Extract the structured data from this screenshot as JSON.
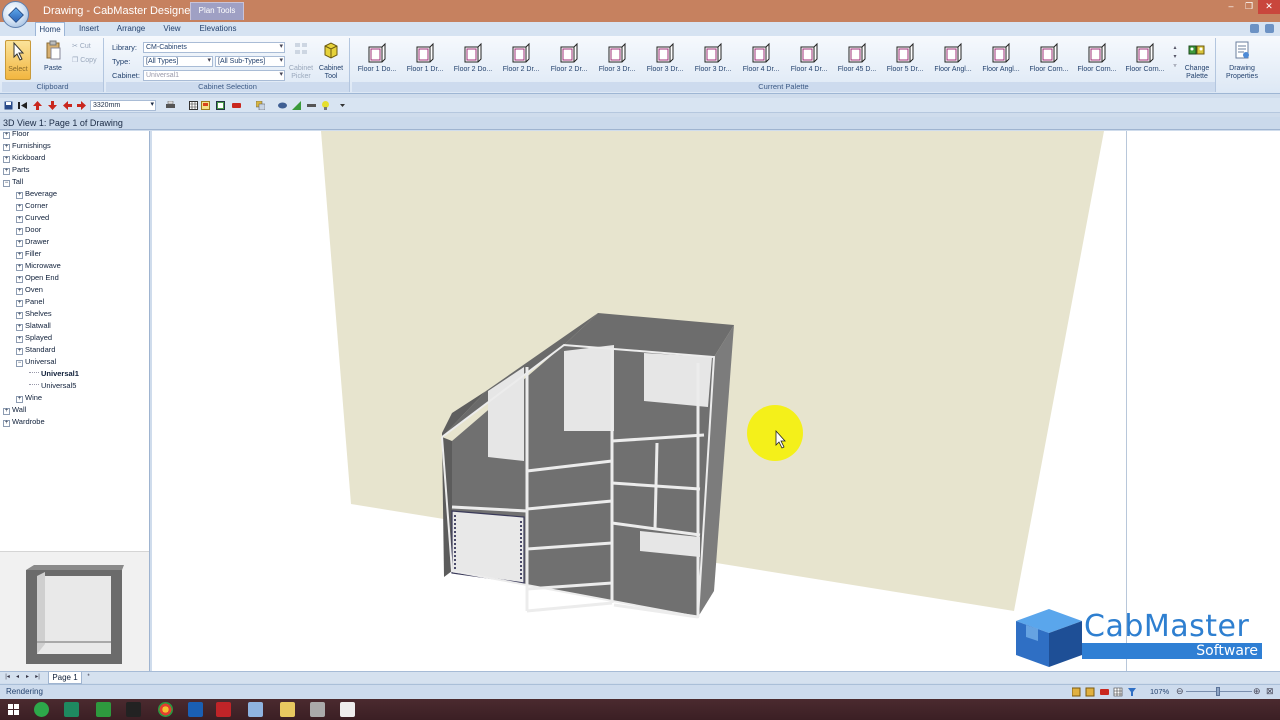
{
  "window": {
    "title": "Drawing - CabMaster Designer",
    "context_tab": "Plan Tools",
    "controls": [
      "–",
      "❐",
      "✕"
    ]
  },
  "tabs": [
    "Home",
    "Insert",
    "Arrange",
    "View",
    "Elevations"
  ],
  "ribbon": {
    "clipboard": {
      "select": "Select",
      "paste": "Paste",
      "cut": "Cut",
      "copy": "Copy",
      "label": "Clipboard"
    },
    "cabinet_selection": {
      "library_label": "Library:",
      "library_value": "CM-Cabinets",
      "type_label": "Type:",
      "type_value": "[All Types]",
      "subtype_value": "[All Sub-Types]",
      "cabinet_label": "Cabinet:",
      "cabinet_value": "Universal1",
      "picker": "Cabinet Picker",
      "tool": "Cabinet Tool",
      "label": "Cabinet Selection"
    },
    "palette": {
      "items": [
        "Floor 1 Do...",
        "Floor 1 Dr...",
        "Floor 2 Do...",
        "Floor 2 Dr...",
        "Floor 2 Dr...",
        "Floor 3 Dr...",
        "Floor 3 Dr...",
        "Floor 3 Dr...",
        "Floor 4 Dr...",
        "Floor 4 Dr...",
        "Floor 45 D...",
        "Floor 5 Dr...",
        "Floor Angl...",
        "Floor Angl...",
        "Floor Corn...",
        "Floor Corn...",
        "Floor Corn..."
      ],
      "label": "Current Palette",
      "change": "Change Palette",
      "drawing_props": "Drawing Properties"
    }
  },
  "toolbar": {
    "zoom_value": "3320mm"
  },
  "view": {
    "header": "3D View 1: Page 1 of Drawing"
  },
  "tree": {
    "root_nodes": [
      "Floor",
      "Furnishings",
      "Kickboard",
      "Parts",
      "Tall"
    ],
    "tall_children": [
      "Beverage",
      "Corner",
      "Curved",
      "Door",
      "Drawer",
      "Filler",
      "Microwave",
      "Open End",
      "Oven",
      "Panel",
      "Shelves",
      "Slatwall",
      "Splayed",
      "Standard",
      "Universal"
    ],
    "universal_children": [
      "Universal1",
      "Universal5"
    ],
    "after": [
      "Wine"
    ],
    "bottom_nodes": [
      "Wall",
      "Wardrobe"
    ]
  },
  "brand": {
    "line1": "CabMaster",
    "line2": "Software"
  },
  "pages": {
    "tab": "Page 1"
  },
  "status": {
    "text": "Rendering",
    "zoom": "107%"
  },
  "colors": {
    "titlebar": "#c6815f",
    "wall": "#e7e4ce",
    "cabinet": "#6f6f6f",
    "brand": "#2f7fd4",
    "highlight": "#f4f01a"
  }
}
